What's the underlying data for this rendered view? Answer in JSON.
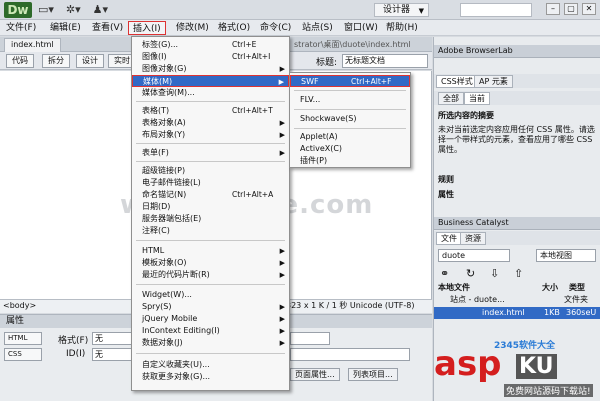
{
  "app": {
    "logo": "Dw"
  },
  "toolbar_icons": [
    "layout-icon",
    "gear-icon",
    "user-icon"
  ],
  "workspace": {
    "label": "设计器"
  },
  "menubar": {
    "items": [
      "文件(F)",
      "编辑(E)",
      "查看(V)",
      "插入(I)",
      "修改(M)",
      "格式(O)",
      "命令(C)",
      "站点(S)",
      "窗口(W)",
      "帮助(H)"
    ]
  },
  "document": {
    "tab": "index.html",
    "path": "strator\\桌面\\duote\\index.html",
    "views": [
      "代码",
      "拆分",
      "设计",
      "实时"
    ],
    "title_label": "标题:",
    "title_value": "无标题文档"
  },
  "statusbar": {
    "tag": "<body>",
    "info": "323 x 1 K / 1 秒 Unicode (UTF-8)"
  },
  "properties": {
    "header": "属性",
    "html_btn": "HTML",
    "css_btn": "CSS",
    "format_label": "格式(F)",
    "format_value": "无",
    "id_label": "ID(I)",
    "id_value": "无",
    "page_props_btn": "页面属性...",
    "list_item_btn": "列表项目..."
  },
  "insert_menu": {
    "items": [
      {
        "label": "标签(G)...",
        "shortcut": "Ctrl+E"
      },
      {
        "label": "图像(I)",
        "shortcut": "Ctrl+Alt+I"
      },
      {
        "label": "图像对象(G)",
        "shortcut": ""
      },
      {
        "label": "媒体(M)",
        "shortcut": ""
      },
      {
        "label": "媒体查询(M)...",
        "shortcut": ""
      },
      {
        "label": "表格(T)",
        "shortcut": "Ctrl+Alt+T"
      },
      {
        "label": "表格对象(A)",
        "shortcut": ""
      },
      {
        "label": "布局对象(Y)",
        "shortcut": ""
      },
      {
        "label": "表单(F)",
        "shortcut": ""
      },
      {
        "label": "超级链接(P)",
        "shortcut": ""
      },
      {
        "label": "电子邮件链接(L)",
        "shortcut": ""
      },
      {
        "label": "命名锚记(N)",
        "shortcut": "Ctrl+Alt+A"
      },
      {
        "label": "日期(D)",
        "shortcut": ""
      },
      {
        "label": "服务器端包括(E)",
        "shortcut": ""
      },
      {
        "label": "注释(C)",
        "shortcut": ""
      },
      {
        "label": "HTML",
        "shortcut": ""
      },
      {
        "label": "模板对象(O)",
        "shortcut": ""
      },
      {
        "label": "最近的代码片断(R)",
        "shortcut": ""
      },
      {
        "label": "Widget(W)...",
        "shortcut": ""
      },
      {
        "label": "Spry(S)",
        "shortcut": ""
      },
      {
        "label": "jQuery Mobile",
        "shortcut": ""
      },
      {
        "label": "InContext Editing(I)",
        "shortcut": ""
      },
      {
        "label": "数据对象(J)",
        "shortcut": ""
      },
      {
        "label": "自定义收藏夹(U)...",
        "shortcut": ""
      },
      {
        "label": "获取更多对象(G)...",
        "shortcut": ""
      }
    ]
  },
  "media_submenu": {
    "items": [
      {
        "label": "SWF",
        "shortcut": "Ctrl+Alt+F"
      },
      {
        "label": "FLV...",
        "shortcut": ""
      },
      {
        "label": "Shockwave(S)",
        "shortcut": ""
      },
      {
        "label": "Applet(A)",
        "shortcut": ""
      },
      {
        "label": "ActiveX(C)",
        "shortcut": ""
      },
      {
        "label": "插件(P)",
        "shortcut": ""
      }
    ]
  },
  "right_panel": {
    "browserlab": "Adobe BrowserLab",
    "css_tabs": [
      "CSS样式",
      "AP 元素"
    ],
    "css_subtabs": [
      "全部",
      "当前"
    ],
    "summary_title": "所选内容的摘要",
    "summary_text": "未对当前选定内容应用任何 CSS 属性。请选择一个带样式的元素，查看应用了哪些 CSS 属性。",
    "rules": "规则",
    "attributes": "属性",
    "business": "Business Catalyst",
    "file_tabs": [
      "文件",
      "资源"
    ],
    "site_select": "duote",
    "view_select": "本地视图",
    "table_headers": [
      "本地文件",
      "大小",
      "类型"
    ],
    "rows": [
      {
        "name": "站点 - duote...",
        "size": "",
        "type": "文件夹"
      },
      {
        "name": "index.html",
        "size": "1KB",
        "type": "360seU"
      }
    ]
  },
  "watermarks": {
    "center": "www.DuoTe.com",
    "asp": "asp",
    "ku": "KU",
    "small": "免费网站源码下载站!",
    "top": "2345软件大全"
  }
}
